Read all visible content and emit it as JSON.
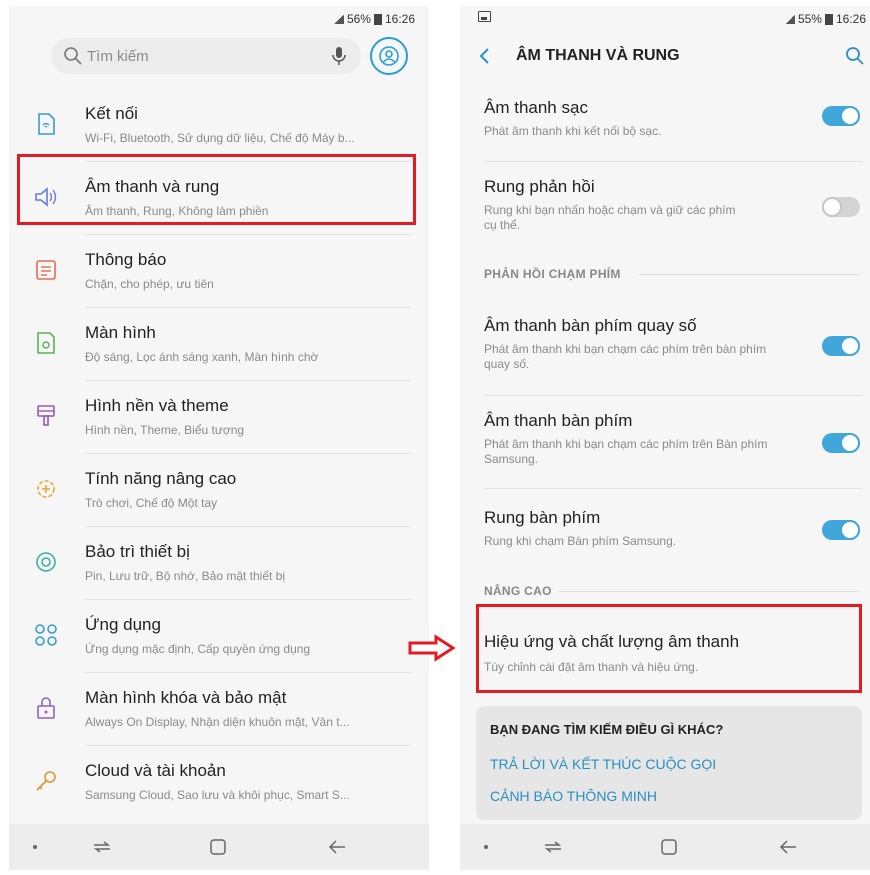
{
  "left_screen": {
    "status": {
      "signal": ".ıl",
      "battery": "56%",
      "time": "16:26"
    },
    "search": {
      "placeholder": "Tìm kiếm"
    },
    "items": [
      {
        "title": "Kết nối",
        "subtitle": "Wi-Fi, Bluetooth, Sử dụng dữ liệu, Chế độ Máy b...",
        "icon": "connection-icon"
      },
      {
        "title": "Âm thanh và rung",
        "subtitle": "Âm thanh, Rung, Không làm phiền",
        "icon": "speaker-icon"
      },
      {
        "title": "Thông báo",
        "subtitle": "Chặn, cho phép, ưu tiên",
        "icon": "notification-icon"
      },
      {
        "title": "Màn hình",
        "subtitle": "Độ sáng, Lọc ánh sáng xanh, Màn hình chờ",
        "icon": "display-icon"
      },
      {
        "title": "Hình nền và theme",
        "subtitle": "Hình nền, Theme, Biểu tượng",
        "icon": "brush-icon"
      },
      {
        "title": "Tính năng nâng cao",
        "subtitle": "Trò chơi, Chế độ Một tay",
        "icon": "gear-plus-icon"
      },
      {
        "title": "Bảo trì thiết bị",
        "subtitle": "Pin, Lưu trữ, Bộ nhớ, Bảo mật thiết bị",
        "icon": "maintenance-icon"
      },
      {
        "title": "Ứng dụng",
        "subtitle": "Ứng dụng mặc định, Cấp quyền ứng dụng",
        "icon": "apps-icon"
      },
      {
        "title": "Màn hình khóa và bảo mật",
        "subtitle": "Always On Display, Nhận diện khuôn mặt, Vân t...",
        "icon": "lock-icon"
      },
      {
        "title": "Cloud và tài khoản",
        "subtitle": "Samsung Cloud, Sao lưu và khôi phục, Smart S...",
        "icon": "key-icon"
      }
    ]
  },
  "right_screen": {
    "status": {
      "signal": ".ıl",
      "battery": "55%",
      "time": "16:26"
    },
    "header": {
      "title": "ÂM THANH VÀ RUNG"
    },
    "items": [
      {
        "title": "Âm thanh sạc",
        "subtitle": "Phát âm thanh khi kết nối bộ sạc.",
        "toggle": true
      },
      {
        "title": "Rung phản hồi",
        "subtitle": "Rung khi bạn nhấn hoặc chạm và giữ các phím cụ thể.",
        "toggle": false
      },
      {
        "title": "Âm thanh bàn phím quay số",
        "subtitle": "Phát âm thanh khi bạn chạm các phím trên bàn phím quay số.",
        "toggle": true
      },
      {
        "title": "Âm thanh bàn phím",
        "subtitle": "Phát âm thanh khi bạn chạm các phím trên Bàn phím Samsung.",
        "toggle": true
      },
      {
        "title": "Rung bàn phím",
        "subtitle": "Rung khi chạm Bàn phím Samsung.",
        "toggle": true
      },
      {
        "title": "Hiệu ứng và chất lượng âm thanh",
        "subtitle": "Tùy chỉnh cài đặt âm thanh và hiệu ứng."
      }
    ],
    "sections": {
      "keyboard_feedback": "PHẢN HỒI CHẠM PHÍM",
      "advanced": "NÂNG CAO"
    },
    "suggest": {
      "question": "BẠN ĐANG TÌM KIẾM ĐIỀU GÌ KHÁC?",
      "link1": "TRẢ LỜI VÀ KẾT THÚC CUỘC GỌI",
      "link2": "CẢNH BÁO THÔNG MINH"
    }
  },
  "colors": {
    "accent": "#41a6d9",
    "highlight": "#e31b23",
    "link": "#2a8fc2"
  }
}
